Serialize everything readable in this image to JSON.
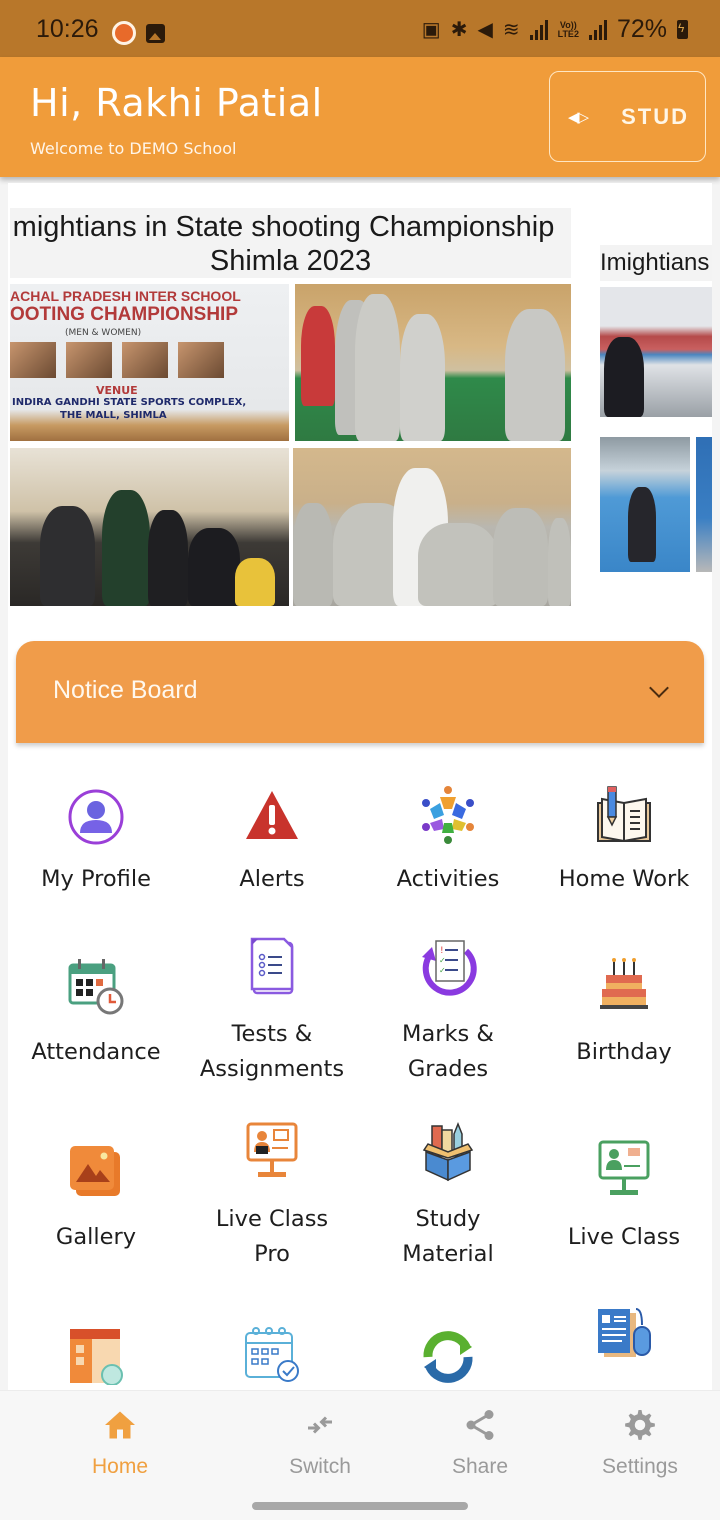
{
  "status_bar": {
    "time": "10:26",
    "battery": "72%",
    "network_label": "Vo)) LTE2"
  },
  "header": {
    "greeting": "Hi, Rakhi Patial",
    "welcome": "Welcome to DEMO School",
    "role_button_label": "STUD",
    "role_button_icon": "swap-horizontal-icon",
    "color": "#f09c3a"
  },
  "banners": [
    {
      "title_line1": "mightians in State shooting Championship",
      "title_line2": "Shimla 2023",
      "poster_text": {
        "line1": "ACHAL PRADESH INTER SCHOOL",
        "line2": "OOTING CHAMPIONSHIP",
        "line3": "(MEN & WOMEN)",
        "venue": "VENUE",
        "address1": "INDIRA GANDHI STATE SPORTS COMPLEX,",
        "address2": "THE MALL, SHIMLA"
      }
    },
    {
      "title_line1": "Imightians"
    }
  ],
  "notice_board": {
    "label": "Notice Board",
    "color": "#f09c4a"
  },
  "menu": [
    {
      "label": "My Profile",
      "icon": "profile-icon"
    },
    {
      "label": "Alerts",
      "icon": "alert-icon"
    },
    {
      "label": "Activities",
      "icon": "activities-icon"
    },
    {
      "label": "Home Work",
      "icon": "homework-icon"
    },
    {
      "label": "Attendance",
      "icon": "attendance-icon"
    },
    {
      "label": "Tests &\nAssignments",
      "line1": "Tests &",
      "line2": "Assignments",
      "icon": "tests-icon"
    },
    {
      "label": "Marks &\nGrades",
      "line1": "Marks &",
      "line2": "Grades",
      "icon": "marks-icon"
    },
    {
      "label": "Birthday",
      "icon": "birthday-cake-icon"
    },
    {
      "label": "Gallery",
      "icon": "gallery-icon"
    },
    {
      "label": "Live Class\nPro",
      "line1": "Live Class",
      "line2": "Pro",
      "icon": "live-class-pro-icon"
    },
    {
      "label": "Study\nMaterial",
      "line1": "Study",
      "line2": "Material",
      "icon": "study-material-icon"
    },
    {
      "label": "Live Class",
      "icon": "live-class-icon"
    },
    {
      "label": "",
      "icon": "timetable-icon"
    },
    {
      "label": "",
      "icon": "calendar-check-icon"
    },
    {
      "label": "",
      "icon": "sync-icon"
    },
    {
      "label": "",
      "icon": "resume-mouse-icon"
    }
  ],
  "bottom_nav": {
    "items": [
      {
        "label": "Home",
        "icon": "home-icon",
        "active": true
      },
      {
        "label": "Switch",
        "icon": "switch-arrows-icon",
        "active": false
      },
      {
        "label": "Share",
        "icon": "share-icon",
        "active": false
      },
      {
        "label": "Settings",
        "icon": "gear-icon",
        "active": false
      }
    ],
    "active_color": "#f0a040",
    "inactive_color": "#9a9a9a"
  }
}
